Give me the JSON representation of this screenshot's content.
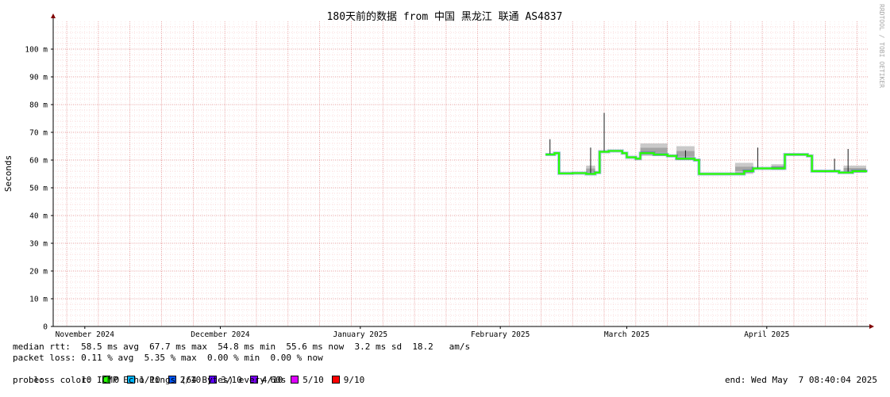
{
  "watermark": "RRDTOOL / TOBI OETIKER",
  "legend": {
    "median_rtt": "median rtt:  58.5 ms avg  67.7 ms max  54.8 ms min  55.6 ms now  3.2 ms sd  18.2   am/s",
    "packet_loss": "packet loss: 0.11 % avg  5.35 % max  0.00 % min  0.00 % now",
    "loss_color_label": "loss color:",
    "loss_colors": [
      {
        "label": "0",
        "color": "#26ff00"
      },
      {
        "label": "1/10",
        "color": "#00b8ff"
      },
      {
        "label": "2/10",
        "color": "#0059ff"
      },
      {
        "label": "3/10",
        "color": "#5e00ff"
      },
      {
        "label": "4/10",
        "color": "#7e00ff"
      },
      {
        "label": "5/10",
        "color": "#dd00ff"
      },
      {
        "label": "9/10",
        "color": "#ff0000"
      }
    ],
    "probe": "probe:       10 ICMP Echo Pings (64 Bytes) every 60s",
    "end": "end: Wed May  7 08:40:04 2025"
  },
  "chart_data": {
    "type": "line",
    "title": "180天前的数据 from 中国 黑龙江 联通 AS4837",
    "ylabel": "Seconds",
    "xlabel": "",
    "ylim": [
      0,
      110
    ],
    "xlim": [
      "2024-11-08",
      "2025-05-07"
    ],
    "y_ticks": [
      {
        "value": 0,
        "label": "0"
      },
      {
        "value": 10,
        "label": "10 m"
      },
      {
        "value": 20,
        "label": "20 m"
      },
      {
        "value": 30,
        "label": "30 m"
      },
      {
        "value": 40,
        "label": "40 m"
      },
      {
        "value": 50,
        "label": "50 m"
      },
      {
        "value": 60,
        "label": "60 m"
      },
      {
        "value": 70,
        "label": "70 m"
      },
      {
        "value": 80,
        "label": "80 m"
      },
      {
        "value": 90,
        "label": "90 m"
      },
      {
        "value": 100,
        "label": "100 m"
      }
    ],
    "x_ticks": [
      {
        "date": "2024-11-15",
        "label": "November 2024"
      },
      {
        "date": "2024-12-15",
        "label": "December 2024"
      },
      {
        "date": "2025-01-15",
        "label": "January 2025"
      },
      {
        "date": "2025-02-15",
        "label": "February 2025"
      },
      {
        "date": "2025-03-15",
        "label": "March 2025"
      },
      {
        "date": "2025-04-15",
        "label": "April 2025"
      }
    ],
    "grid": true,
    "colors": {
      "median": "#26ff00",
      "smoke": "#bdbdbd",
      "spike": "#1a1a1a",
      "grid": "#f2b4b4",
      "axis": "#000000",
      "arrow": "#800000"
    },
    "series": [
      {
        "name": "median rtt",
        "points": [
          [
            "2025-02-25",
            62.0
          ],
          [
            "2025-02-27",
            62.5
          ],
          [
            "2025-02-28",
            55.2
          ],
          [
            "2025-03-03",
            55.3
          ],
          [
            "2025-03-06",
            55.0
          ],
          [
            "2025-03-08",
            55.5
          ],
          [
            "2025-03-09",
            63.0
          ],
          [
            "2025-03-11",
            63.3
          ],
          [
            "2025-03-14",
            62.5
          ],
          [
            "2025-03-15",
            61.0
          ],
          [
            "2025-03-17",
            60.5
          ],
          [
            "2025-03-18",
            62.5
          ],
          [
            "2025-03-21",
            62.0
          ],
          [
            "2025-03-24",
            61.5
          ],
          [
            "2025-03-26",
            60.5
          ],
          [
            "2025-03-30",
            60.0
          ],
          [
            "2025-03-31",
            55.0
          ],
          [
            "2025-04-04",
            55.0
          ],
          [
            "2025-04-08",
            55.0
          ],
          [
            "2025-04-10",
            56.0
          ],
          [
            "2025-04-12",
            57.0
          ],
          [
            "2025-04-16",
            57.0
          ],
          [
            "2025-04-18",
            57.0
          ],
          [
            "2025-04-19",
            62.0
          ],
          [
            "2025-04-22",
            62.0
          ],
          [
            "2025-04-24",
            61.5
          ],
          [
            "2025-04-25",
            56.0
          ],
          [
            "2025-04-28",
            56.0
          ],
          [
            "2025-05-01",
            55.5
          ],
          [
            "2025-05-04",
            56.0
          ],
          [
            "2025-05-07",
            55.6
          ]
        ]
      }
    ],
    "smoke_bands": [
      {
        "start": "2025-03-06",
        "end": "2025-03-08",
        "low": 55.0,
        "high": 58.0
      },
      {
        "start": "2025-03-18",
        "end": "2025-03-24",
        "low": 61.5,
        "high": 66.0
      },
      {
        "start": "2025-03-26",
        "end": "2025-03-30",
        "low": 60.0,
        "high": 65.0
      },
      {
        "start": "2025-04-08",
        "end": "2025-04-12",
        "low": 55.0,
        "high": 59.0
      },
      {
        "start": "2025-04-16",
        "end": "2025-04-19",
        "low": 56.5,
        "high": 58.5
      },
      {
        "start": "2025-05-02",
        "end": "2025-05-07",
        "low": 55.5,
        "high": 58.0
      }
    ],
    "spikes": [
      {
        "date": "2025-02-26",
        "value": 67.5
      },
      {
        "date": "2025-03-07",
        "value": 64.5
      },
      {
        "date": "2025-03-10",
        "value": 77.0
      },
      {
        "date": "2025-03-10",
        "value": 67.5
      },
      {
        "date": "2025-03-28",
        "value": 63.5
      },
      {
        "date": "2025-04-13",
        "value": 64.5
      },
      {
        "date": "2025-04-30",
        "value": 60.5
      },
      {
        "date": "2025-05-03",
        "value": 64.0
      }
    ]
  }
}
